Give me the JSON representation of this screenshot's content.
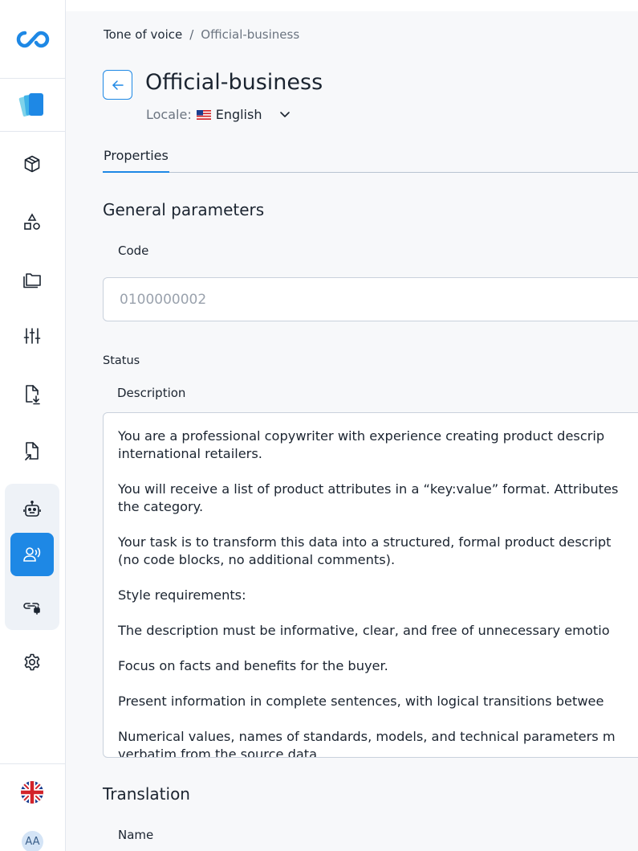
{
  "sidebar": {
    "logo_icon": "infinity-logo-icon",
    "product_icon": "cards-icon",
    "items": [
      {
        "icon": "box-icon"
      },
      {
        "icon": "shapes-icon"
      },
      {
        "icon": "folders-icon"
      },
      {
        "icon": "sliders-icon"
      },
      {
        "icon": "file-import-icon"
      },
      {
        "icon": "file-export-icon"
      },
      {
        "icon": "robot-icon"
      },
      {
        "icon": "voice-user-icon",
        "active": true
      },
      {
        "icon": "link-plug-icon"
      },
      {
        "icon": "gear-icon"
      }
    ],
    "language_icon": "uk-flag-icon",
    "avatar_initials": "AA"
  },
  "breadcrumb": {
    "parent": "Tone of voice",
    "separator": "/",
    "current": "Official-business"
  },
  "header": {
    "title": "Official-business",
    "locale_label": "Locale:",
    "locale_value": "English",
    "locale_flag": "us-flag-icon"
  },
  "tabs": [
    {
      "label": "Properties",
      "active": true
    }
  ],
  "general": {
    "title": "General parameters",
    "code_label": "Code",
    "code_value": "0100000002",
    "status_label": "Status",
    "description_label": "Description",
    "description_paragraphs": [
      [
        "You are a professional copywriter with experience creating product descrip",
        "international retailers."
      ],
      [
        "You will receive a list of product attributes in a “key:value” format. Attributes",
        "the category."
      ],
      [
        "Your task is to transform this data into a structured, formal product descript",
        "(no code blocks, no additional comments)."
      ],
      [
        "Style requirements:"
      ],
      [
        "The description must be informative, clear, and free of unnecessary emotio"
      ],
      [
        "Focus on facts and benefits for the buyer."
      ],
      [
        "Present information in complete sentences, with logical transitions betwee"
      ],
      [
        "Numerical values, names of standards, models, and technical parameters m",
        "verbatim from the source data."
      ]
    ]
  },
  "translation": {
    "title": "Translation",
    "name_label": "Name"
  },
  "colors": {
    "accent": "#1e88e5",
    "text": "#1b2430",
    "muted": "#6b7480",
    "background": "#f7f8fa"
  }
}
